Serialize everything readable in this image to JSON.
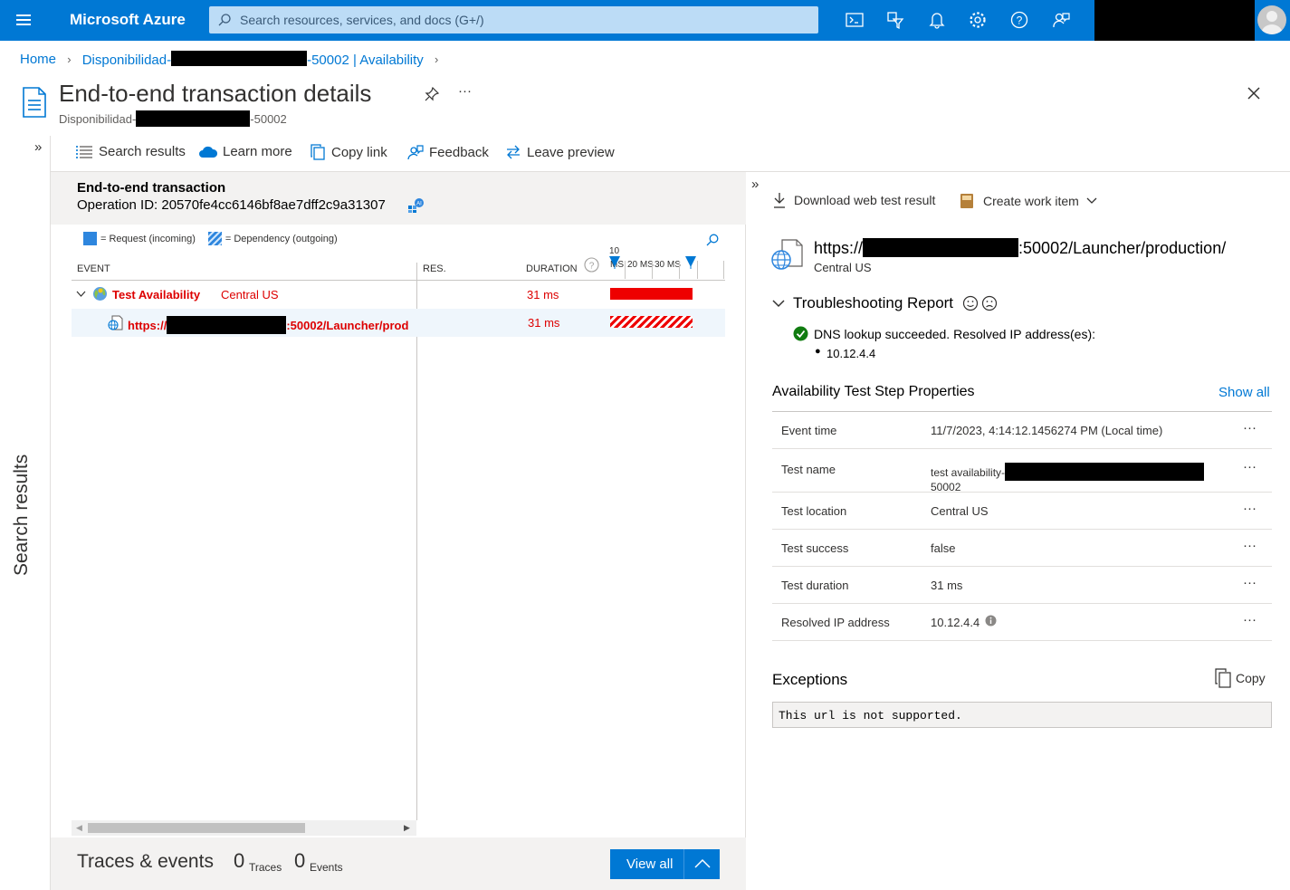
{
  "topbar": {
    "brand": "Microsoft Azure",
    "search_placeholder": "Search resources, services, and docs (G+/)",
    "icons": [
      "cloud-shell-icon",
      "directory-filter-icon",
      "notifications-icon",
      "settings-icon",
      "help-icon",
      "feedback-icon"
    ]
  },
  "breadcrumb": {
    "home": "Home",
    "resource_prefix": "Disponibilidad-",
    "resource_suffix": "-50002 | Availability"
  },
  "header": {
    "title": "End-to-end transaction details",
    "subtitle_prefix": "Disponibilidad-",
    "subtitle_suffix": "-50002",
    "more": "···"
  },
  "left_rail": {
    "label": "Search results",
    "expand": "»"
  },
  "toolbar": {
    "search_results": "Search results",
    "learn_more": "Learn more",
    "copy_link": "Copy link",
    "feedback": "Feedback",
    "leave_preview": "Leave preview"
  },
  "transaction": {
    "title": "End-to-end transaction",
    "operation_id": "Operation ID: 20570fe4cc6146bf8ae7dff2c9a31307",
    "legend_request": "= Request (incoming)",
    "legend_dependency": "= Dependency (outgoing)",
    "columns": {
      "event": "EVENT",
      "res": "RES.",
      "duration": "DURATION"
    },
    "timeline_ticks": [
      "10",
      "MS",
      "20 MS",
      "30 MS"
    ],
    "rows": [
      {
        "name": "Test Availability",
        "location": "Central US",
        "duration": "31 ms",
        "bar_fraction": 1.0
      },
      {
        "name_prefix": "https://",
        "name_suffix": ":50002/Launcher/prod",
        "duration": "31 ms",
        "bar_fraction": 1.0
      }
    ]
  },
  "traces": {
    "title": "Traces & events",
    "traces_count": "0",
    "traces_label": "Traces",
    "events_count": "0",
    "events_label": "Events",
    "view_all": "View all"
  },
  "details": {
    "collapse": "»",
    "download": "Download web test result",
    "create_work_item": "Create work item",
    "url_prefix": "https://",
    "url_suffix": ":50002/Launcher/production/",
    "location": "Central US",
    "troubleshooting": "Troubleshooting Report",
    "dns_message": "DNS lookup succeeded. Resolved IP address(es):",
    "dns_ip": "10.12.4.4",
    "properties_title": "Availability Test Step Properties",
    "show_all": "Show all",
    "properties": [
      {
        "key": "Event time",
        "value": "11/7/2023, 4:14:12.1456274 PM (Local time)"
      },
      {
        "key": "Test name",
        "value": "test availability-",
        "value_line2": "50002"
      },
      {
        "key": "Test location",
        "value": "Central US"
      },
      {
        "key": "Test success",
        "value": "false"
      },
      {
        "key": "Test duration",
        "value": "31 ms"
      },
      {
        "key": "Resolved IP address",
        "value": "10.12.4.4"
      }
    ],
    "row_more": "···",
    "exceptions_title": "Exceptions",
    "copy": "Copy",
    "exception_message": "This url is not supported."
  },
  "colors": {
    "azure_blue": "#0078d4",
    "error_red": "#dd0000",
    "success_green": "#107c10"
  }
}
